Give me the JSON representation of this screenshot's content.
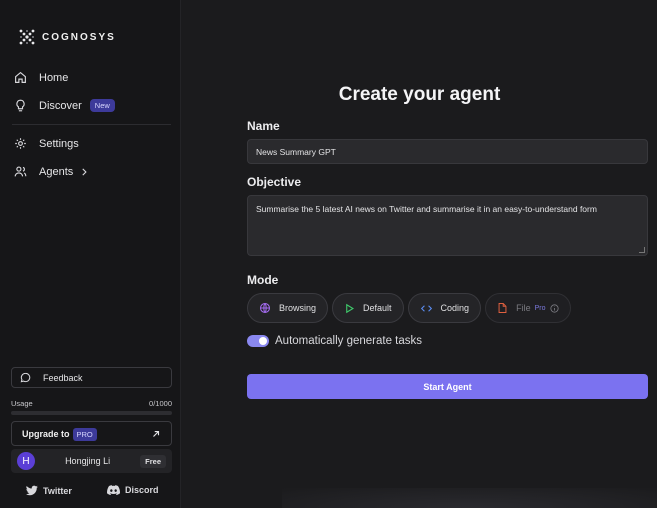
{
  "brand": {
    "name": "COGNOSYS"
  },
  "sidebar": {
    "nav": [
      {
        "label": "Home",
        "icon": "home-icon"
      },
      {
        "label": "Discover",
        "icon": "lightbulb-icon",
        "badge": "New"
      },
      {
        "label": "Settings",
        "icon": "gear-icon"
      },
      {
        "label": "Agents",
        "icon": "users-icon"
      }
    ],
    "feedback_label": "Feedback",
    "usage": {
      "label": "Usage",
      "value": "0/1000",
      "fraction": 0
    },
    "upgrade": {
      "label": "Upgrade to",
      "badge": "PRO"
    },
    "user": {
      "initial": "H",
      "name": "Hongjing Li",
      "plan": "Free"
    },
    "social": {
      "twitter": "Twitter",
      "discord": "Discord"
    }
  },
  "main": {
    "title": "Create your agent",
    "name_label": "Name",
    "name_value": "News Summary GPT",
    "objective_label": "Objective",
    "objective_value": "Summarise the 5 latest AI news on Twitter and summarise it in an easy-to-understand form",
    "mode_label": "Mode",
    "modes": [
      {
        "label": "Browsing",
        "icon": "globe-icon",
        "color": "#a46bf0"
      },
      {
        "label": "Default",
        "icon": "play-icon",
        "color": "#3fca6b"
      },
      {
        "label": "Coding",
        "icon": "code-icon",
        "color": "#5b8cf0"
      },
      {
        "label": "File",
        "icon": "file-icon",
        "color": "#e0603f",
        "badge": "Pro"
      }
    ],
    "auto_tasks_label": "Automatically generate tasks",
    "auto_tasks_on": true,
    "start_button": "Start Agent"
  },
  "colors": {
    "accent": "#7b72f0",
    "badge": "#3d3a9a"
  }
}
